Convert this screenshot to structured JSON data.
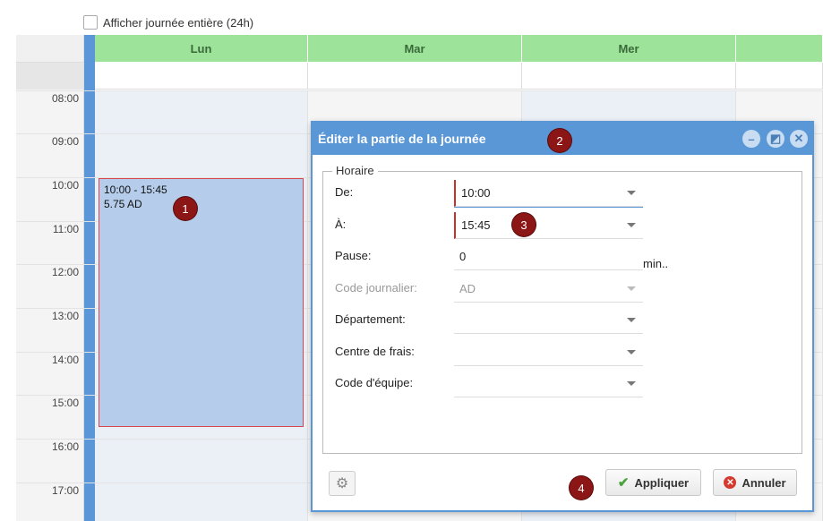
{
  "options": {
    "full_day_label": "Afficher journée entière (24h)"
  },
  "calendar": {
    "days": [
      "Lun",
      "Mar",
      "Mer"
    ],
    "hours": [
      "08:00",
      "09:00",
      "10:00",
      "11:00",
      "12:00",
      "13:00",
      "14:00",
      "15:00",
      "16:00",
      "17:00"
    ],
    "event": {
      "time_range": "10:00 - 15:45",
      "summary": "5.75 AD"
    }
  },
  "badges": [
    "1",
    "2",
    "3",
    "4"
  ],
  "dialog": {
    "title": "Éditer la partie de la journée",
    "section_legend": "Horaire",
    "fields": [
      {
        "label": "De:",
        "value": "10:00"
      },
      {
        "label": "À:",
        "value": "15:45"
      },
      {
        "label": "Pause:",
        "value": "0",
        "unit": "min.."
      },
      {
        "label": "Code journalier:",
        "value": "AD"
      },
      {
        "label": "Département:",
        "value": ""
      },
      {
        "label": "Centre de frais:",
        "value": ""
      },
      {
        "label": "Code d'équipe:",
        "value": ""
      }
    ],
    "buttons": {
      "apply": "Appliquer",
      "cancel": "Annuler"
    }
  },
  "colors": {
    "day_header": "#9de39a",
    "accent_blue": "#5a97d6",
    "event_fill": "#b5cdeb",
    "event_border": "#d9454a",
    "badge": "#8c1515",
    "required_marker": "#c9302c"
  }
}
